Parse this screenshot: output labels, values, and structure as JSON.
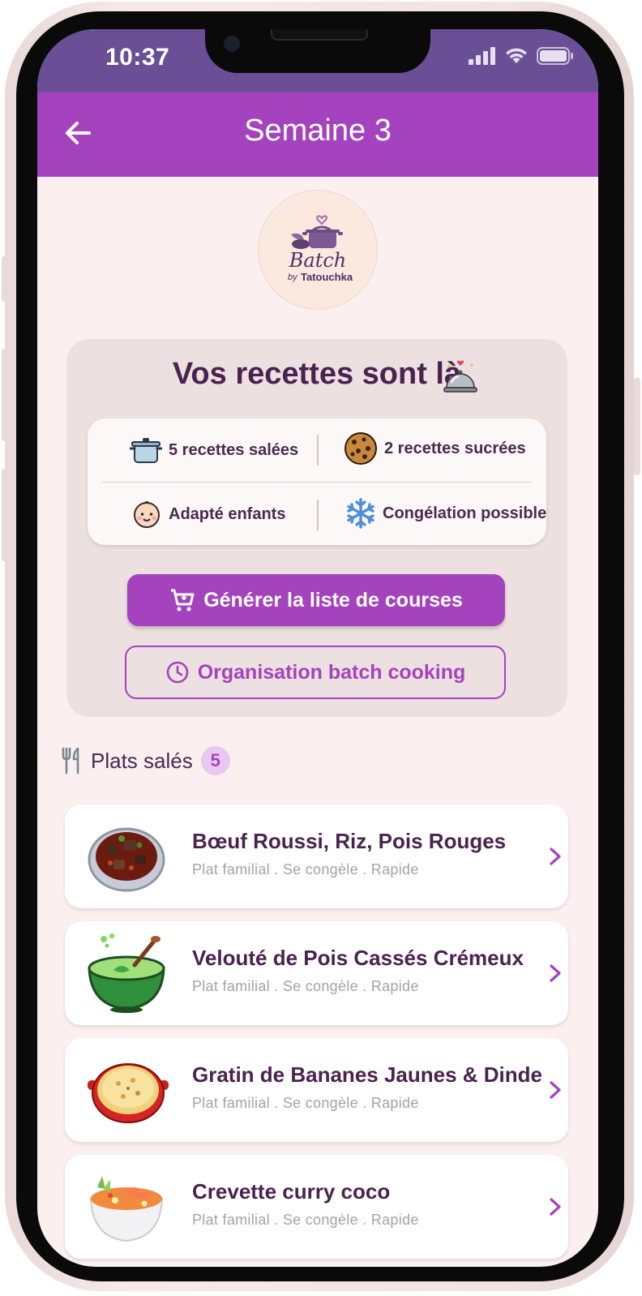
{
  "status_bar": {
    "time": "10:37"
  },
  "app_bar": {
    "title": "Semaine 3"
  },
  "logo": {
    "brand": "Batch",
    "by": "by",
    "author": "Tatouchka"
  },
  "hero": {
    "title": "Vos recettes sont là",
    "features": [
      {
        "icon": "pot-icon",
        "label": "5 recettes salées"
      },
      {
        "icon": "cookie-icon",
        "label": "2 recettes sucrées"
      },
      {
        "icon": "baby-face-icon",
        "label": "Adapté enfants"
      },
      {
        "icon": "snowflake-icon",
        "label": "Congélation possible"
      }
    ],
    "primary_button": "Générer la liste de courses",
    "secondary_button": "Organisation batch cooking"
  },
  "section": {
    "title": "Plats salés",
    "count": "5"
  },
  "recipes": [
    {
      "name": "Bœuf Roussi, Riz, Pois Rouges",
      "meta": "Plat familial . Se congèle . Rapide",
      "image": "beef-stew-icon"
    },
    {
      "name": "Velouté de Pois Cassés Crémeux",
      "meta": "Plat familial . Se congèle . Rapide",
      "image": "green-soup-icon"
    },
    {
      "name": "Gratin de Bananes Jaunes & Dinde",
      "meta": "Plat familial . Se congèle . Rapide",
      "image": "gratin-dish-icon"
    },
    {
      "name": "Crevette curry coco",
      "meta": "Plat familial . Se congèle . Rapide",
      "image": "shrimp-curry-icon"
    }
  ],
  "colors": {
    "primary": "#a443bd",
    "status_bar": "#6a4f96",
    "background": "#fbf0ef",
    "text_dark": "#4a2250"
  }
}
